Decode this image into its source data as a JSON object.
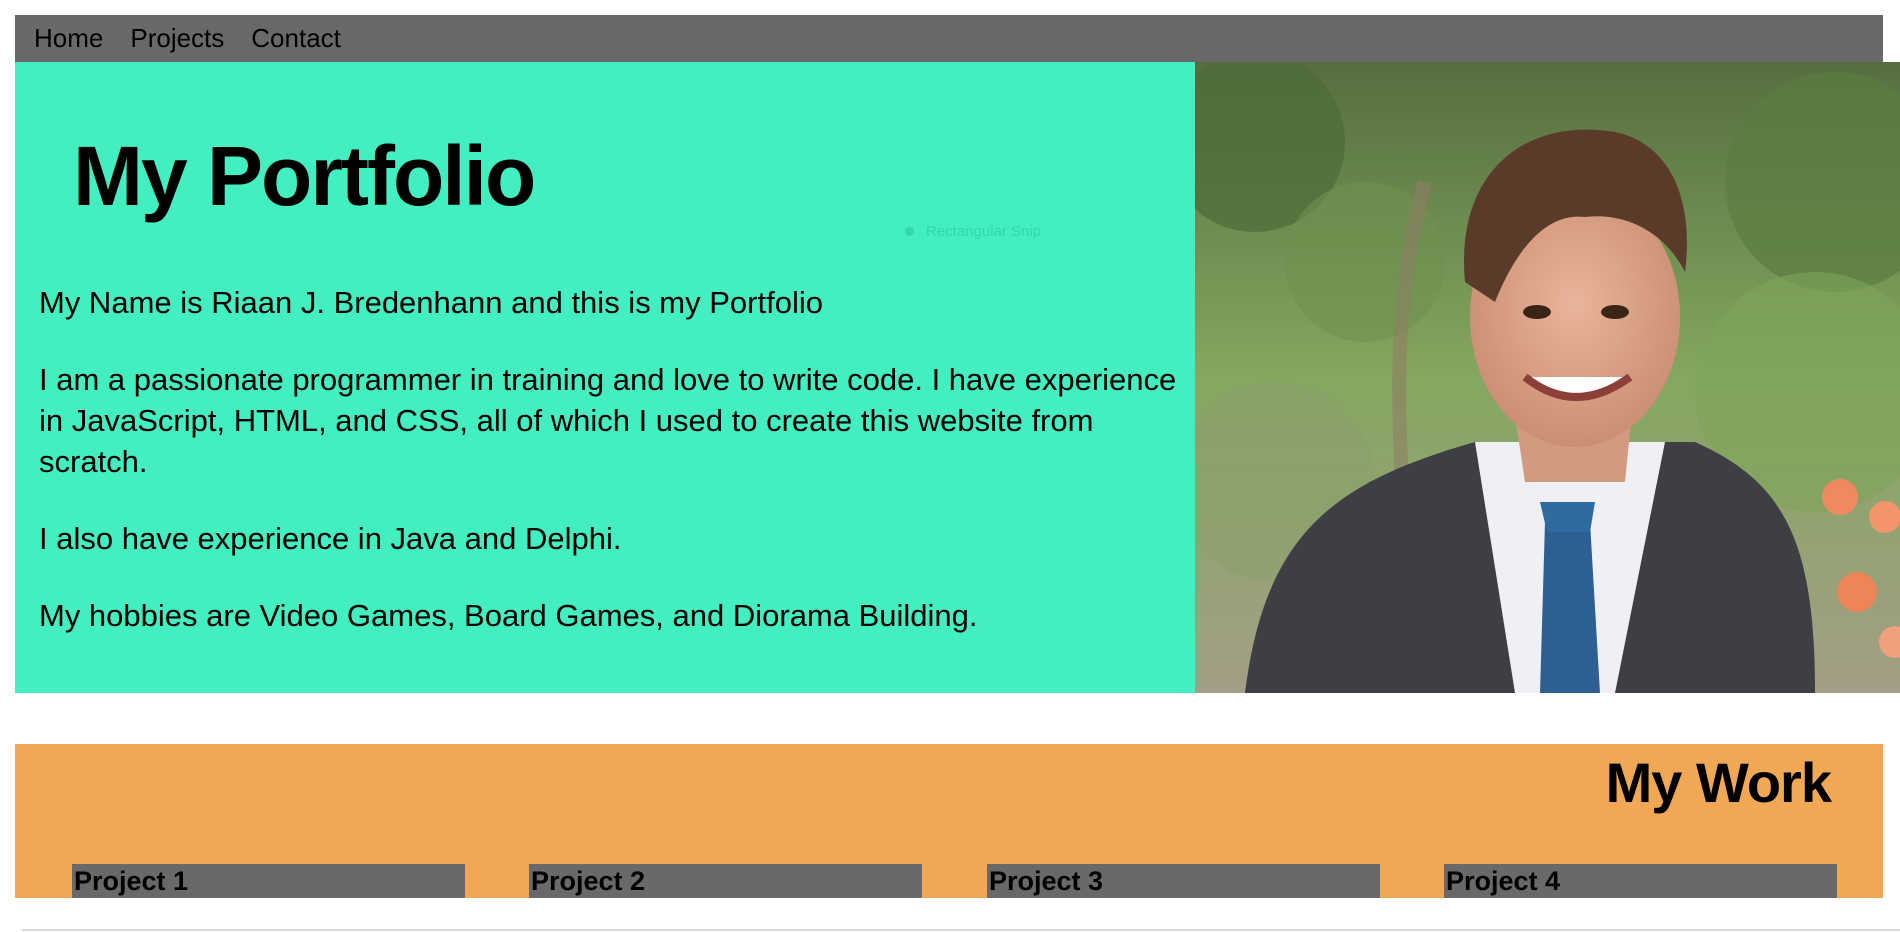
{
  "nav": {
    "items": [
      "Home",
      "Projects",
      "Contact"
    ]
  },
  "hero": {
    "title": "My Portfolio",
    "ghost_label": "Rectangular Snip",
    "paragraphs": [
      "My Name is Riaan J. Bredenhann and this is my Portfolio",
      "I am a passionate programmer in training and love to write code. I have experience in JavaScript, HTML, and CSS, all of which I used to create this website from scratch.",
      "I also have experience in Java and Delphi.",
      "My hobbies are Video Games, Board Games, and Diorama Building."
    ]
  },
  "work": {
    "title": "My Work",
    "projects": [
      "Project 1",
      "Project 2",
      "Project 3",
      "Project 4"
    ]
  },
  "colors": {
    "nav_bg": "#696969",
    "hero_bg": "#43eec0",
    "work_bg": "#f1a855",
    "project_bg": "#696969"
  }
}
